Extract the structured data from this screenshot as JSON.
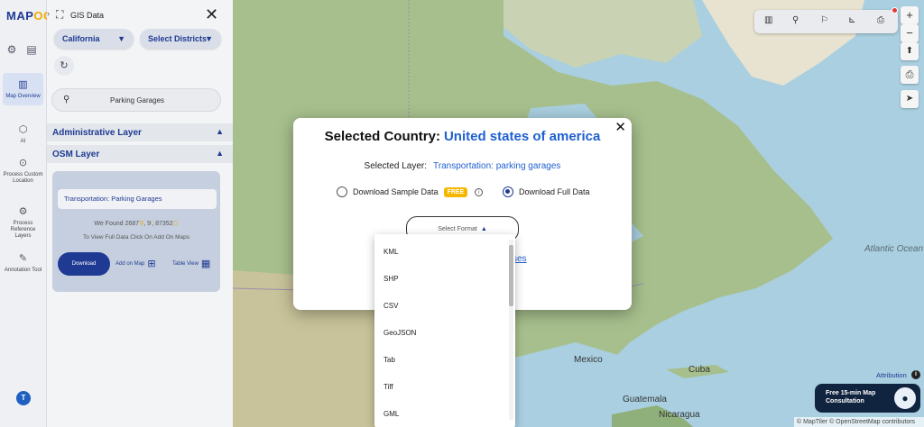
{
  "app": {
    "logo_main": "MAP",
    "logo_accent": "OG"
  },
  "rail": {
    "items": [
      {
        "label": "Map Overview",
        "icon": "book-map-icon"
      },
      {
        "label": "AI",
        "icon": "ai-chip-icon"
      },
      {
        "label": "Process Custom Location",
        "icon": "location-pin-icon"
      },
      {
        "label": "Process Reference Layers",
        "icon": "gear-icon"
      },
      {
        "label": "Annotation Tool",
        "icon": "annotation-icon"
      }
    ],
    "avatar": "T"
  },
  "panel": {
    "title": "GIS Data",
    "state": "California",
    "districts": "Select Districts",
    "search_value": "Parking Garages",
    "sections": {
      "admin": "Administrative Layer",
      "osm": "OSM Layer"
    },
    "card": {
      "layer_name": "Transportation: Parking Garages",
      "found_prefix": "We Found",
      "count_1": "2687",
      "count_2": "9",
      "count_3": "87352",
      "hint": "To View Full Data Click On Add On Maps",
      "download": "Download",
      "add_on_map": "Add on Map",
      "table_view": "Table View"
    }
  },
  "map": {
    "labels": {
      "ocean": "Atlantic Ocean",
      "mexico": "Mexico",
      "cuba": "Cuba",
      "guatemala": "Guatemala",
      "nicaragua": "Nicaragua"
    },
    "attribution": "Attribution",
    "copyright": "© MapTiler © OpenStreetMap contributors",
    "consult": "Free 15-min Map Consultation"
  },
  "modal": {
    "title_prefix": "Selected Country:",
    "country": "United states of america",
    "layer_label": "Selected Layer:",
    "layer_value": "Transportation: parking garages",
    "sample_option": "Download Sample Data",
    "free_badge": "FREE",
    "full_option": "Download Full Data",
    "format_placeholder": "Select Format",
    "link_fragment": "ses"
  },
  "formats": [
    "KML",
    "SHP",
    "CSV",
    "GeoJSON",
    "Tab",
    "Tiff",
    "GML"
  ],
  "colors": {
    "brand": "#1f3a93",
    "accent": "#f2a900",
    "link": "#1f5fd0",
    "free": "#f5b800"
  }
}
